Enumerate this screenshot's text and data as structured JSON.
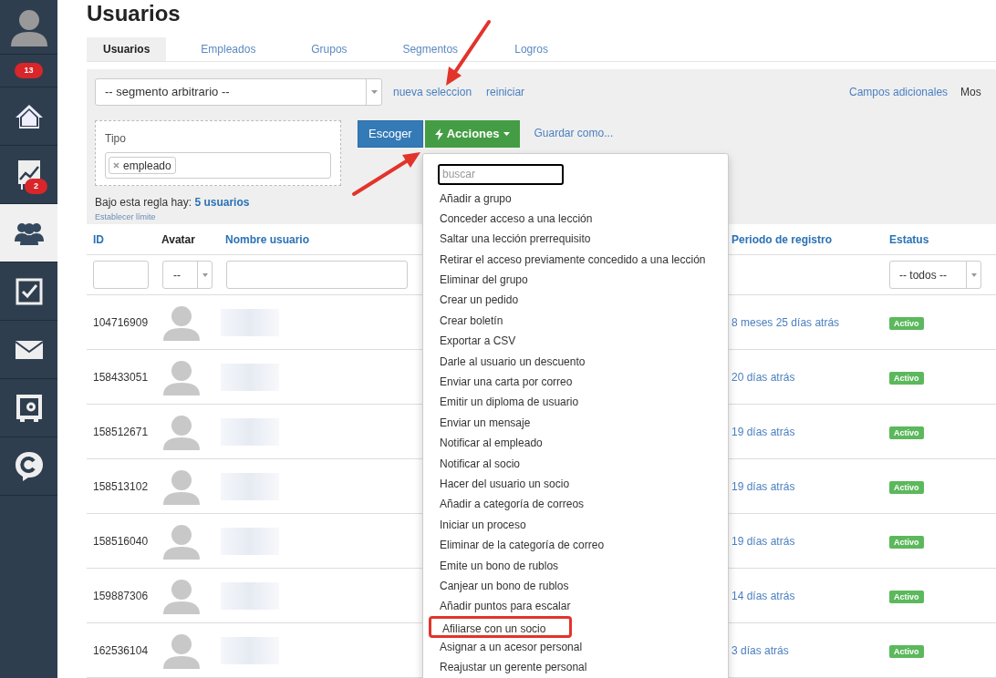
{
  "sidebar": {
    "items": [
      {
        "kind": "avatar",
        "selected": false
      },
      {
        "kind": "counter",
        "badge": "13",
        "selected": false
      },
      {
        "kind": "home",
        "selected": false
      },
      {
        "kind": "chart",
        "badge": "2",
        "selected": false
      },
      {
        "kind": "users",
        "selected": true
      },
      {
        "kind": "tasks",
        "selected": false
      },
      {
        "kind": "mail",
        "selected": false
      },
      {
        "kind": "safe",
        "selected": false
      },
      {
        "kind": "chat",
        "selected": false
      }
    ]
  },
  "title": "Usuarios",
  "tabs": [
    {
      "label": "Usuarios",
      "selected": true
    },
    {
      "label": "Empleados",
      "selected": false
    },
    {
      "label": "Grupos",
      "selected": false
    },
    {
      "label": "Segmentos",
      "selected": false
    },
    {
      "label": "Logros",
      "selected": false
    }
  ],
  "filter": {
    "segment": "-- segmento arbitrario --",
    "links": [
      "nueva seleccion",
      "reiniciar"
    ],
    "right_links": [
      "Campos adicionales",
      "Mos"
    ],
    "rule": {
      "label": "Tipo",
      "tags": [
        "empleado"
      ]
    },
    "summary": "Bajo esta regla hay: **5 usuarios**",
    "limit_link": "Establecer límite",
    "buttons": {
      "choose": "Escoger",
      "actions": "Acciones",
      "save_as": "Guardar como..."
    }
  },
  "actions_menu": {
    "search_placeholder": "buscar",
    "items": [
      {
        "label": "Añadir a grupo",
        "highlighted": false
      },
      {
        "label": "Conceder acceso a una lección",
        "highlighted": false
      },
      {
        "label": "Saltar una lección prerrequisito",
        "highlighted": false
      },
      {
        "label": "Retirar el acceso previamente concedido a una lección",
        "highlighted": false
      },
      {
        "label": "Eliminar del grupo",
        "highlighted": false
      },
      {
        "label": "Crear un pedido",
        "highlighted": false
      },
      {
        "label": "Crear boletín",
        "highlighted": false
      },
      {
        "label": "Exportar a CSV",
        "highlighted": false
      },
      {
        "label": "Darle al usuario un descuento",
        "highlighted": false
      },
      {
        "label": "Enviar una carta por correo",
        "highlighted": false
      },
      {
        "label": "Emitir un diploma de usuario",
        "highlighted": false
      },
      {
        "label": "Enviar un mensaje",
        "highlighted": false
      },
      {
        "label": "Notificar al empleado",
        "highlighted": false
      },
      {
        "label": "Notificar al socio",
        "highlighted": false
      },
      {
        "label": "Hacer del usuario un socio",
        "highlighted": false
      },
      {
        "label": "Añadir a categoría de correos",
        "highlighted": false
      },
      {
        "label": "Iniciar un proceso",
        "highlighted": false
      },
      {
        "label": "Eliminar de la categoría de correo",
        "highlighted": false
      },
      {
        "label": "Emite un bono de rublos",
        "highlighted": false
      },
      {
        "label": "Canjear un bono de rublos",
        "highlighted": false
      },
      {
        "label": "Añadir puntos para escalar",
        "highlighted": false
      },
      {
        "label": "Afiliarse con un socio",
        "highlighted": true
      },
      {
        "label": "Asignar a un acesor personal",
        "highlighted": false
      },
      {
        "label": "Reajustar un gerente personal",
        "highlighted": false
      }
    ]
  },
  "table": {
    "columns": [
      "ID",
      "Avatar",
      "Nombre usuario",
      "Periodo de registro",
      "Estatus"
    ],
    "avatar_filter": "--",
    "status_filter": "-- todos --",
    "rows": [
      {
        "id": "104716909",
        "period": "8 meses 25 días atrás",
        "status": "Activo"
      },
      {
        "id": "158433051",
        "period": "20 días atrás",
        "status": "Activo"
      },
      {
        "id": "158512671",
        "period": "19 días atrás",
        "status": "Activo"
      },
      {
        "id": "158513102",
        "period": "19 días atrás",
        "status": "Activo"
      },
      {
        "id": "158516040",
        "period": "19 días atrás",
        "status": "Activo"
      },
      {
        "id": "159887306",
        "period": "14 días atrás",
        "status": "Activo"
      },
      {
        "id": "162536104",
        "period": "3 días atrás",
        "status": "Activo"
      }
    ]
  }
}
